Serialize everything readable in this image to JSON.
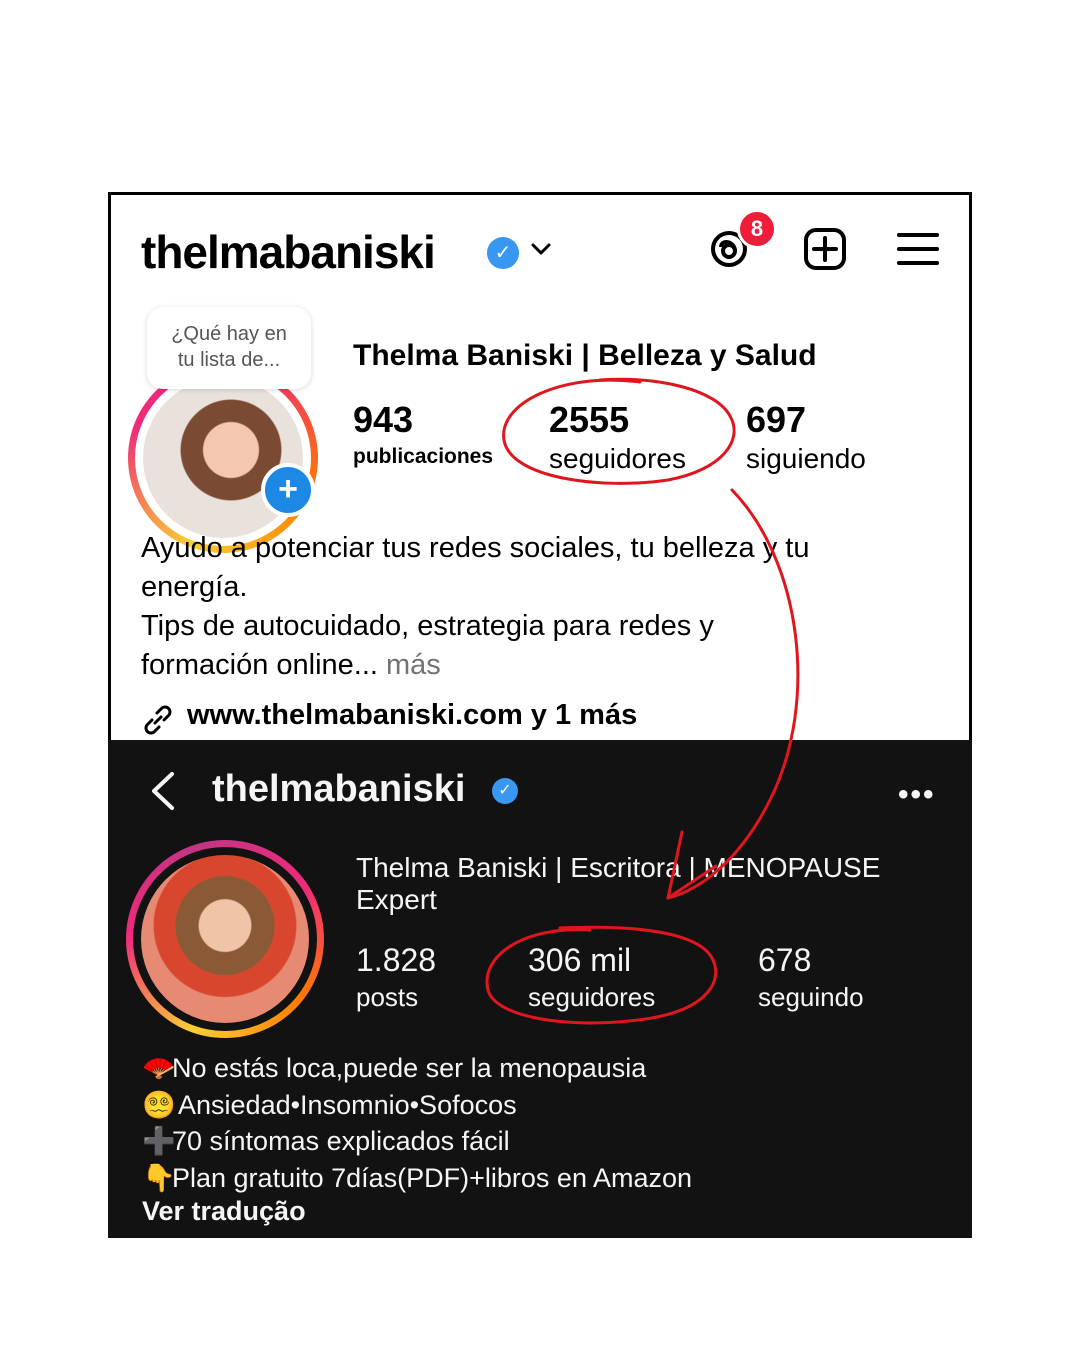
{
  "top_profile": {
    "username": "thelmabaniski",
    "verified_icon": "verified-badge-icon",
    "threads_badge_count": "8",
    "note_text_line1": "¿Qué hay en",
    "note_text_line2": "tu lista de...",
    "full_name": "Thelma Baniski | Belleza y Salud",
    "posts_count": "943",
    "posts_label": "publicaciones",
    "followers_count": "2555",
    "followers_label": "seguidores",
    "following_count": "697",
    "following_label": "siguiendo",
    "bio_line1": "Ayudo a potenciar tus redes sociales, tu belleza y tu",
    "bio_line2": "energía.",
    "bio_line3": "Tips de autocuidado, estrategia para redes y",
    "bio_line4_main": "formación online",
    "bio_line4_ellipsis": "...",
    "bio_more": " más",
    "link_text": "www.thelmabaniski.com y 1 más"
  },
  "bottom_profile": {
    "username": "thelmabaniski",
    "more_label": "•••",
    "full_name_line1": "Thelma Baniski | Escritora | MENOPAUSE",
    "full_name_line2": "Expert",
    "posts_count": "1.828",
    "posts_label": "posts",
    "followers_count": "306 mil",
    "followers_label": "seguidores",
    "following_count": "678",
    "following_label": "seguindo",
    "bio_lines": [
      {
        "emoji": "🪭",
        "text": "No estás loca,puede ser la menopausia"
      },
      {
        "emoji": "😵‍💫",
        "text": " Ansiedad•Insomnio•Sofocos"
      },
      {
        "emoji": "➕",
        "text": "70 síntomas explicados fácil"
      },
      {
        "emoji": "👇",
        "text": "Plan gratuito 7días(PDF)+libros en Amazon"
      }
    ],
    "translate_label": "Ver tradução"
  },
  "annotation_color": "#e0161f",
  "accent_blue": "#3897f0"
}
